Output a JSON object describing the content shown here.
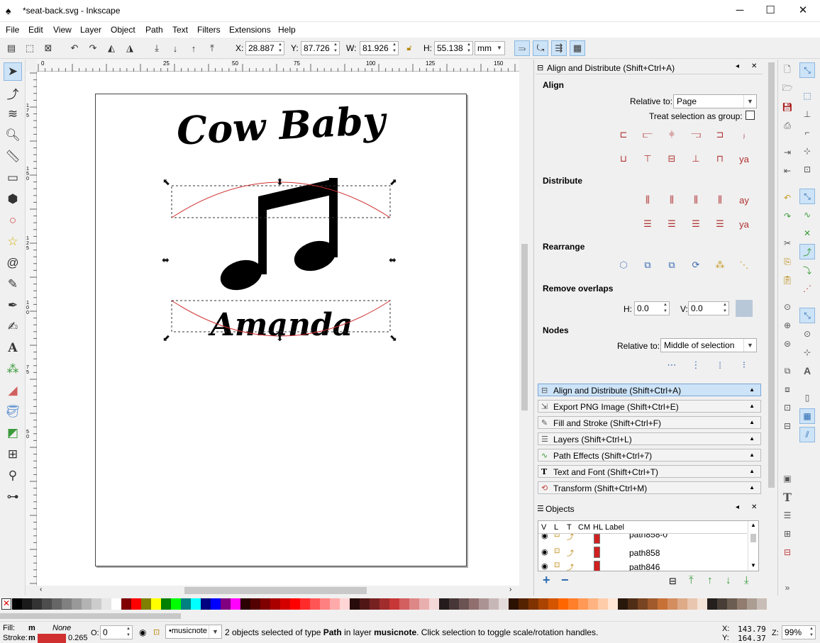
{
  "window": {
    "title": "*seat-back.svg - Inkscape",
    "min": "─",
    "max": "☐",
    "close": "✕"
  },
  "menu": [
    "File",
    "Edit",
    "View",
    "Layer",
    "Object",
    "Path",
    "Text",
    "Filters",
    "Extensions",
    "Help"
  ],
  "cmdbar": {
    "x_label": "X:",
    "x": "28.887",
    "y_label": "Y:",
    "y": "87.726",
    "w_label": "W:",
    "w": "81.926",
    "h_label": "H:",
    "h": "55.138",
    "unit": "mm"
  },
  "ruler": {
    "h": [
      "0",
      "25",
      "50",
      "75",
      "100",
      "125",
      "150"
    ],
    "v": [
      "1 7 5",
      "1 5 0",
      "1 2 5",
      "1 0 0",
      "7 5",
      "5 0"
    ]
  },
  "canvas_text": {
    "top": "Cow Baby",
    "bottom": "Amanda"
  },
  "align": {
    "header": "Align and Distribute (Shift+Ctrl+A)",
    "align": "Align",
    "relative_to_label": "Relative to:",
    "relative_to": "Page",
    "treat_group": "Treat selection as group:",
    "distribute": "Distribute",
    "rearrange": "Rearrange",
    "remove_overlaps": "Remove overlaps",
    "h_label": "H:",
    "h_val": "0.0",
    "v_label": "V:",
    "v_val": "0.0",
    "nodes": "Nodes",
    "nodes_rel_label": "Relative to:",
    "nodes_rel": "Middle of selection"
  },
  "panels": [
    "Align and Distribute (Shift+Ctrl+A)",
    "Export PNG Image (Shift+Ctrl+E)",
    "Fill and Stroke (Shift+Ctrl+F)",
    "Layers (Shift+Ctrl+L)",
    "Path Effects  (Shift+Ctrl+7)",
    "Text and Font (Shift+Ctrl+T)",
    "Transform (Shift+Ctrl+M)"
  ],
  "objects": {
    "header": "Objects",
    "cols": [
      "V",
      "L",
      "T",
      "CM",
      "HL",
      "Label"
    ],
    "rows": [
      "path858-0",
      "path858",
      "path846"
    ],
    "add": "+",
    "remove": "−"
  },
  "status": {
    "fill_label": "Fill:",
    "fill_m": "m",
    "fill_val": "None",
    "stroke_label": "Stroke:",
    "stroke_m": "m",
    "stroke_w": "0.265",
    "opacity_label": "O:",
    "opacity": "0",
    "layer": "•musicnote",
    "msg_a": "2 objects selected of type ",
    "msg_b": "Path",
    "msg_c": " in layer ",
    "msg_d": "musicnote",
    "msg_e": ". Click selection to toggle scale/rotation handles.",
    "cx_label": "X:",
    "cx": "143.79",
    "cy_label": "Y:",
    "cy": "164.37",
    "zoom_label": "Z:",
    "zoom": "99%"
  },
  "colors": {
    "accent": "#cde3f7",
    "stroke": "#d03030",
    "palette": [
      "#000000",
      "#1a1a1a",
      "#333333",
      "#4d4d4d",
      "#666666",
      "#808080",
      "#999999",
      "#b3b3b3",
      "#cccccc",
      "#e6e6e6",
      "#ffffff",
      "#800000",
      "#ff0000",
      "#808000",
      "#ffff00",
      "#008000",
      "#00ff00",
      "#008080",
      "#00ffff",
      "#000080",
      "#0000ff",
      "#800080",
      "#ff00ff",
      "#2b0000",
      "#550000",
      "#800000",
      "#aa0000",
      "#d40000",
      "#ff0000",
      "#ff2a2a",
      "#ff5555",
      "#ff8080",
      "#ffaaaa",
      "#ffd5d5",
      "#280b0b",
      "#501616",
      "#782121",
      "#a02c2c",
      "#c83737",
      "#d35f5f",
      "#de8787",
      "#e9afaf",
      "#f4d7d7",
      "#241c1c",
      "#483737",
      "#6c5353",
      "#916f6f",
      "#ac9393",
      "#c8b7b7",
      "#e3dbdb",
      "#2b1100",
      "#552200",
      "#803300",
      "#aa4400",
      "#d45500",
      "#ff6600",
      "#ff7f2a",
      "#ff9955",
      "#ffb380",
      "#ffccaa",
      "#ffe6d5",
      "#28170b",
      "#502d16",
      "#784421",
      "#a05a2c",
      "#c87137",
      "#d38d5f",
      "#deaa87",
      "#e9c6af",
      "#f4e3d7",
      "#241f1c",
      "#483e37",
      "#6c5d53",
      "#917c6f",
      "#ac9d93",
      "#c8beb7"
    ]
  }
}
